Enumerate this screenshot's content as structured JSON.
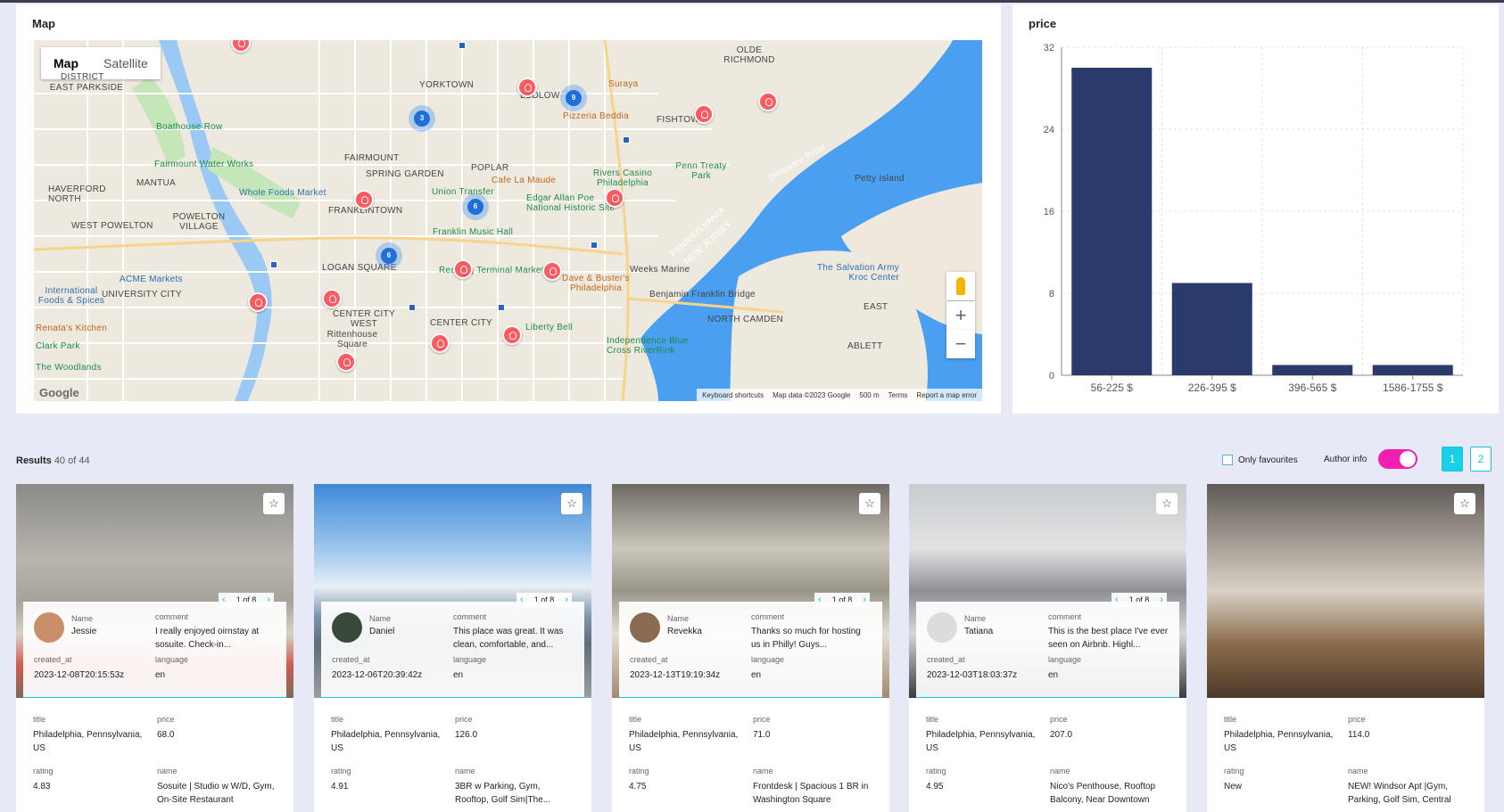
{
  "map": {
    "title": "Map",
    "type_map": "Map",
    "type_satellite": "Satellite",
    "zoom_in": "+",
    "zoom_out": "−",
    "footer": [
      "Keyboard shortcuts",
      "Map data ©2023 Google",
      "500 m",
      "Terms",
      "Report a map error"
    ],
    "google_logo": "Google",
    "labels": [
      "YORKTOWN",
      "LUDLOW",
      "FISHTOWN",
      "OLDE RICHMOND",
      "FAIRMOUNT",
      "SPRING GARDEN",
      "POPLAR",
      "FRANKLINTOWN",
      "LOGAN SQUARE",
      "CENTER CITY WEST",
      "CENTER CITY",
      "EAST PARKSIDE",
      "MANTUA",
      "HAVERFORD NORTH",
      "WEST POWELTON",
      "POWELTON VILLAGE",
      "UNIVERSITY CITY",
      "NORTH CAMDEN",
      "Petty Island",
      "PENNSYLVANIA",
      "NEW JERSEY",
      "Delaware River",
      "Rittenhouse Square",
      "Boathouse Row",
      "Fairmount Water Works",
      "Whole Foods Market",
      "Union Transfer",
      "Cafe La Maude",
      "Rivers Casino Philadelphia",
      "Penn Treaty Park",
      "Edgar Allan Poe National Historic Site",
      "Franklin Music Hall",
      "Reading Terminal Market",
      "Dave & Buster's Philadelphia",
      "Weeks Marine",
      "Benjamin Franklin Bridge",
      "Liberty Bell",
      "Independence Blue Cross RiverRink",
      "ACME Markets",
      "International Foods & Spices",
      "Renata's Kitchen",
      "Clark Park",
      "The Woodlands",
      "Suraya",
      "Pizzeria Beddia",
      "The Salvation Army Kroc Center",
      "ABLETT",
      "EAST",
      "DISTRICT"
    ],
    "clusters": [
      "3",
      "9",
      "6",
      "6"
    ]
  },
  "chart_data": {
    "type": "bar",
    "title": "price",
    "categories": [
      "56-225 $",
      "226-395 $",
      "396-565 $",
      "1586-1755 $"
    ],
    "values": [
      30,
      9,
      1,
      1
    ],
    "ylim": [
      0,
      32
    ],
    "yticks": [
      "0",
      "8",
      "16",
      "24",
      "32"
    ],
    "grid": true,
    "bar_color": "#2a3a6b"
  },
  "results": {
    "label": "Results",
    "count": "40 of 44",
    "only_favourites": "Only favourites",
    "author_info": "Author info",
    "pages": [
      "1",
      "2"
    ]
  },
  "labels": {
    "name": "Name",
    "comment": "comment",
    "created_at": "created_at",
    "language": "language",
    "title": "title",
    "price": "price",
    "rating": "rating",
    "listing_name": "name",
    "star": "☆"
  },
  "cards": [
    {
      "pager": "1 of 8",
      "author": "Jessie",
      "comment": "I really enjoyed oirnstay at sosuite. Check-in...",
      "created_at": "2023-12-08T20:15:53z",
      "language": "en",
      "title": "Philadelphia, Pennsylvania, US",
      "price": "68.0",
      "rating": "4.83",
      "name": "Sosuite | Studio w W/D, Gym, On-Site Restaurant"
    },
    {
      "pager": "1 of 8",
      "author": "Daniel",
      "comment": "This place was great. It was clean, comfortable, and...",
      "created_at": "2023-12-06T20:39:42z",
      "language": "en",
      "title": "Philadelphia, Pennsylvania, US",
      "price": "126.0",
      "rating": "4.91",
      "name": "3BR w Parking, Gym, Rooftop, Golf Sim|The..."
    },
    {
      "pager": "1 of 8",
      "author": "Revekka",
      "comment": "Thanks so much for hosting us in Philly! Guys...",
      "created_at": "2023-12-13T19:19:34z",
      "language": "en",
      "title": "Philadelphia, Pennsylvania, US",
      "price": "71.0",
      "rating": "4.75",
      "name": "Frontdesk | Spacious 1 BR in Washington Square"
    },
    {
      "pager": "1 of 8",
      "author": "Tatiana",
      "comment": "This is the best place I've ever seen on Airbnb. Highl...",
      "created_at": "2023-12-03T18:03:37z",
      "language": "en",
      "title": "Philadelphia, Pennsylvania, US",
      "price": "207.0",
      "rating": "4.95",
      "name": "Nico's Penthouse, Rooftop Balcony, Near Downtown"
    },
    {
      "title": "Philadelphia, Pennsylvania, US",
      "price": "114.0",
      "rating": "New",
      "name": "NEW! Windsor Apt |Gym, Parking, Golf Sim, Central"
    }
  ]
}
